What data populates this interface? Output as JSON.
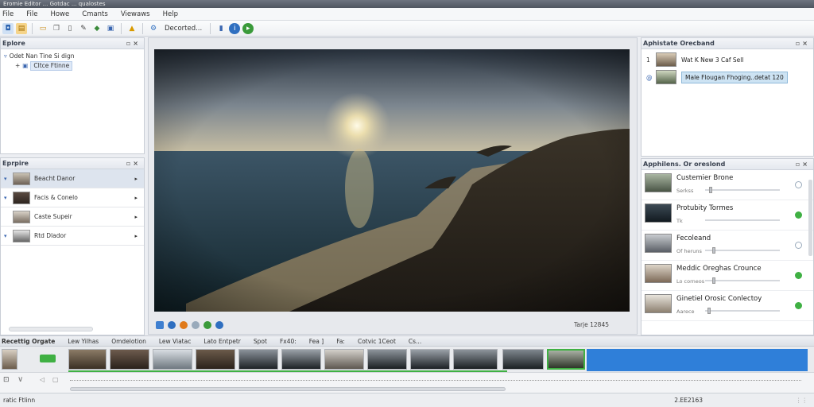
{
  "window": {
    "title": "Eromie Editor ... Gotdac ... qualostes"
  },
  "menu": [
    "File",
    "File",
    "Howe",
    "Cmants",
    "Viewaws",
    "Help"
  ],
  "toolbar": {
    "label": "Decorted..."
  },
  "explorer": {
    "title": "Eplore",
    "tree": [
      {
        "label": "Odet Nan Tine Si dign"
      },
      {
        "label": "Cltce Ftinne"
      }
    ]
  },
  "episodes": {
    "title": "Eprpire",
    "items": [
      {
        "label": "Beacht Danor"
      },
      {
        "label": "Facis & Conelo"
      },
      {
        "label": "Caste Supeir"
      },
      {
        "label": "Rtd Dlador"
      }
    ]
  },
  "preview": {
    "size_text": "Tarje 12845"
  },
  "subtitles": {
    "title": "Aphistate Orecband",
    "items": [
      {
        "num": "1",
        "label": "Wat K New 3 Caf Sell"
      },
      {
        "num": "@",
        "label": "Male Flougan Fhoging..detat 120"
      }
    ]
  },
  "appliances": {
    "title": "Apphilens. Or oreslond",
    "items": [
      {
        "title": "Custemier Brone",
        "sub": "Serkss",
        "status": "off",
        "level": 0.05
      },
      {
        "title": "Protubity Tormes",
        "sub": "Tk",
        "status": "on",
        "level": 0.0
      },
      {
        "title": "Fecoleand",
        "sub": "Of heruns",
        "status": "off",
        "level": 0.1
      },
      {
        "title": "Meddic Oreghas Crounce",
        "sub": "Lo corneos",
        "status": "on",
        "level": 0.1
      },
      {
        "title": "Ginetiel Orosic Conlectoy",
        "sub": "Aarece",
        "status": "on",
        "level": 0.03
      }
    ]
  },
  "timeline": {
    "tabs": [
      "Recettig Orgate",
      "Lew Yilhas",
      "Omdelotion",
      "Lew Viatac",
      "Lato Entpetr",
      "Spot",
      "Fx40:",
      "Fea ]",
      "Fa:",
      "Cotvic 1Ceot",
      "Cs..."
    ]
  },
  "status": {
    "left": "ratic Ftlinn",
    "right": "2.EE2163"
  },
  "colors": {
    "accent": "#2f7fd9",
    "green": "#3fb043",
    "selection": "#cde3f3"
  }
}
